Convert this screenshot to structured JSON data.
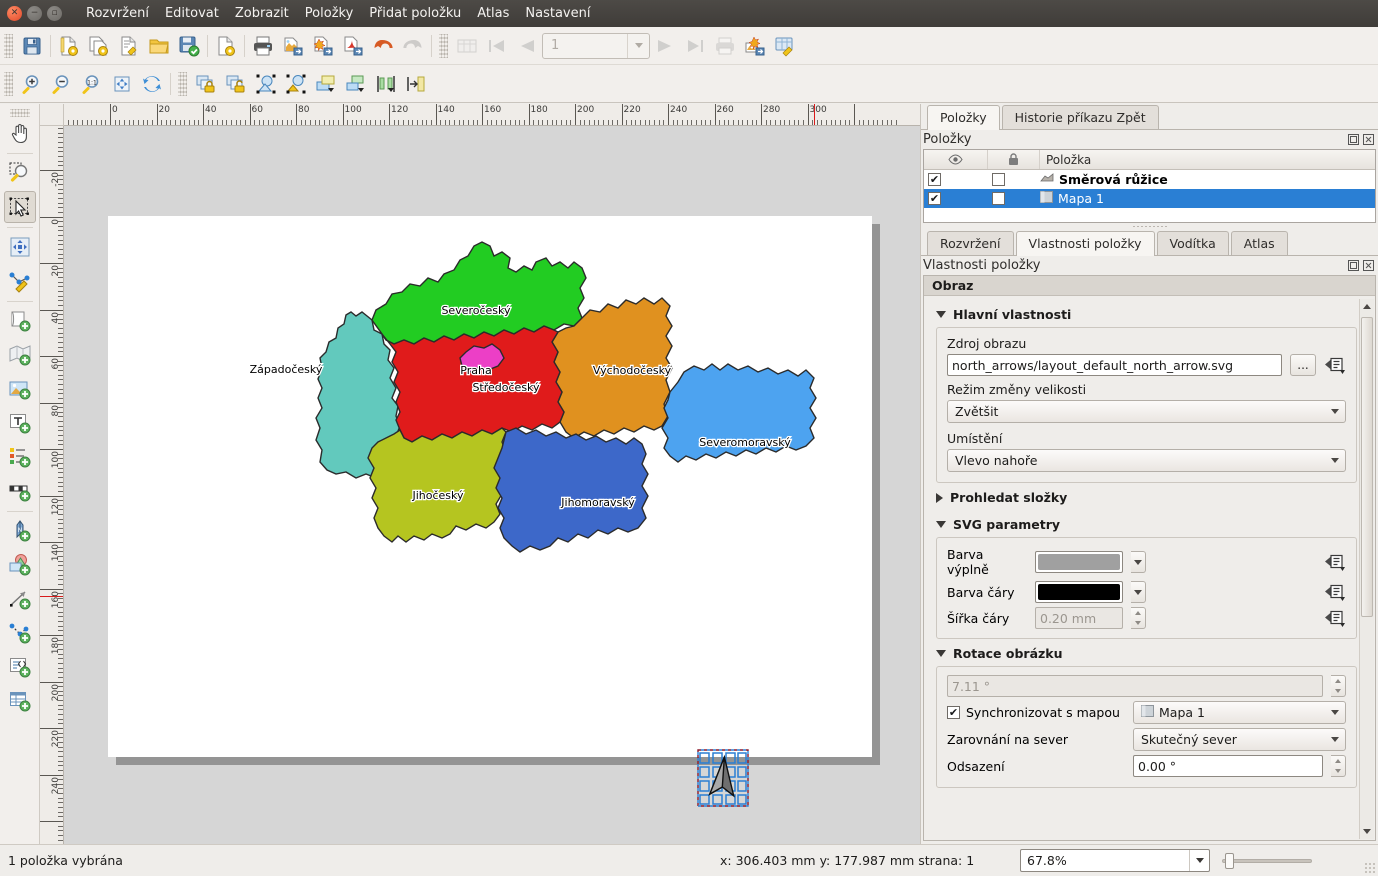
{
  "window": {
    "controls": [
      "close",
      "minimize",
      "maximize"
    ],
    "menus": [
      "Rozvržení",
      "Editovat",
      "Zobrazit",
      "Položky",
      "Přidat položku",
      "Atlas",
      "Nastavení"
    ]
  },
  "toolbar_top": {
    "buttons": [
      {
        "name": "save-icon",
        "tip": "Uložit"
      },
      {
        "name": "new-layout-icon",
        "tip": "Nové rozvržení"
      },
      {
        "name": "duplicate-layout-icon",
        "tip": "Duplikovat rozvržení"
      },
      {
        "name": "layout-manager-icon",
        "tip": "Správce rozvržení"
      },
      {
        "name": "open-folder-icon",
        "tip": "Otevřít"
      },
      {
        "name": "save-template-icon",
        "tip": "Uložit jako šablonu"
      },
      {
        "name": "new-from-template-icon",
        "tip": "Nové z šablony"
      },
      {
        "name": "print-icon",
        "tip": "Tisk"
      },
      {
        "name": "export-image-icon",
        "tip": "Exportovat jako obrázek"
      },
      {
        "name": "export-svg-icon",
        "tip": "Exportovat jako SVG"
      },
      {
        "name": "export-pdf-icon",
        "tip": "Exportovat jako PDF"
      },
      {
        "name": "undo-icon",
        "tip": "Zpět"
      },
      {
        "name": "redo-icon",
        "tip": "Znovu"
      }
    ],
    "atlas": [
      {
        "name": "atlas-preview-icon",
        "tip": "Náhled atlasu"
      },
      {
        "name": "atlas-first-icon",
        "tip": "První prvek"
      },
      {
        "name": "atlas-prev-icon",
        "tip": "Předchozí prvek"
      },
      {
        "name": "atlas-page-input",
        "value": "1"
      },
      {
        "name": "atlas-next-icon",
        "tip": "Další prvek"
      },
      {
        "name": "atlas-last-icon",
        "tip": "Poslední prvek"
      },
      {
        "name": "atlas-print-icon",
        "tip": "Tisknout atlas"
      },
      {
        "name": "atlas-export-image-icon",
        "tip": "Exportovat atlas jako obrázky"
      },
      {
        "name": "atlas-settings-icon",
        "tip": "Nastavení atlasu"
      }
    ]
  },
  "toolbar_second": {
    "buttons": [
      {
        "name": "zoom-in-icon"
      },
      {
        "name": "zoom-out-icon"
      },
      {
        "name": "zoom-100-icon"
      },
      {
        "name": "zoom-full-icon"
      },
      {
        "name": "refresh-icon"
      },
      {
        "name": "lock-items-icon"
      },
      {
        "name": "unlock-items-icon"
      },
      {
        "name": "group-items-icon"
      },
      {
        "name": "ungroup-items-icon"
      },
      {
        "name": "raise-items-icon"
      },
      {
        "name": "lower-items-icon"
      },
      {
        "name": "align-left-icon"
      },
      {
        "name": "distribute-icon"
      }
    ]
  },
  "left_toolbar": {
    "tools": [
      {
        "name": "pan-tool",
        "label": "Posunout obsah"
      },
      {
        "name": "zoom-tool",
        "label": "Přiblížit"
      },
      {
        "name": "select-move-item-tool",
        "label": "Vybrat/přesunout položku",
        "selected": true
      },
      {
        "name": "move-item-content-tool",
        "label": "Posunout obsah položky"
      },
      {
        "name": "edit-nodes-tool",
        "label": "Upravit uzly položky"
      },
      {
        "name": "add-page-tool",
        "label": "Přidat stránky"
      },
      {
        "name": "add-map-tool",
        "label": "Přidat mapu"
      },
      {
        "name": "add-picture-tool",
        "label": "Přidat obrázek"
      },
      {
        "name": "add-label-tool",
        "label": "Přidat popisek"
      },
      {
        "name": "add-legend-tool",
        "label": "Přidat legendu"
      },
      {
        "name": "add-scalebar-tool",
        "label": "Přidat měřítko"
      },
      {
        "name": "add-north-arrow-tool",
        "label": "Přidat směrovou růžici"
      },
      {
        "name": "add-shape-tool",
        "label": "Přidat tvar"
      },
      {
        "name": "add-arrow-tool",
        "label": "Přidat šipku"
      },
      {
        "name": "add-node-item-tool",
        "label": "Přidat uzlovou položku"
      },
      {
        "name": "add-html-tool",
        "label": "Přidat HTML rámec"
      },
      {
        "name": "add-attribute-table-tool",
        "label": "Přidat atributovou tabulku"
      }
    ]
  },
  "rulers": {
    "h_labels": [
      "0",
      "20",
      "40",
      "60",
      "80",
      "100",
      "120",
      "140",
      "160",
      "180",
      "200",
      "220",
      "240",
      "260",
      "280",
      "300"
    ],
    "v_labels": [
      "-20",
      "0",
      "20",
      "40",
      "60",
      "80",
      "100",
      "120",
      "140",
      "160",
      "180",
      "200",
      "220",
      "240"
    ],
    "unit": "mm"
  },
  "canvas": {
    "page_number": 1,
    "map_item_name": "Mapa 1",
    "north_arrow_name": "Směrová růžice",
    "map_regions": [
      {
        "name": "Severočeský",
        "color": "#22cc22"
      },
      {
        "name": "Západočeský",
        "color": "#62c9bd"
      },
      {
        "name": "Středočeský",
        "color": "#e01b1b"
      },
      {
        "name": "Praha",
        "color": "#ec3fc6"
      },
      {
        "name": "Východočeský",
        "color": "#e0911f"
      },
      {
        "name": "Severomoravský",
        "color": "#4da3f0"
      },
      {
        "name": "Jihočeský",
        "color": "#b5c520"
      },
      {
        "name": "Jihomoravský",
        "color": "#3d68c9"
      }
    ]
  },
  "dock": {
    "top_tabs": [
      {
        "label": "Položky",
        "selected": true
      },
      {
        "label": "Historie příkazu Zpět",
        "selected": false
      }
    ],
    "items_panel": {
      "title": "Položky",
      "columns": [
        "eye-icon",
        "lock-icon",
        "Položka"
      ],
      "rows": [
        {
          "visible": true,
          "locked": false,
          "icon": "north-arrow-icon",
          "name": "Směrová růžice",
          "selected": false,
          "bold": true
        },
        {
          "visible": true,
          "locked": false,
          "icon": "map-icon",
          "name": "Mapa 1",
          "selected": true,
          "bold": false
        }
      ]
    },
    "bottom_tabs": [
      {
        "label": "Rozvržení",
        "selected": false
      },
      {
        "label": "Vlastnosti položky",
        "selected": true
      },
      {
        "label": "Vodítka",
        "selected": false
      },
      {
        "label": "Atlas",
        "selected": false
      }
    ],
    "props_panel": {
      "title": "Vlastnosti položky",
      "group": "Obraz",
      "sections": [
        {
          "name": "main-properties",
          "title": "Hlavní vlastnosti",
          "expanded": true,
          "fields": [
            {
              "label": "Zdroj obrazu",
              "type": "text",
              "value": "north_arrows/layout_default_north_arrow.svg",
              "button": "...",
              "has_data_defined": true
            },
            {
              "label": "Režim změny velikosti",
              "type": "combo",
              "value": "Zvětšit"
            },
            {
              "label": "Umístění",
              "type": "combo",
              "value": "Vlevo nahoře"
            }
          ]
        },
        {
          "name": "search-directories",
          "title": "Prohledat složky",
          "expanded": false,
          "fields": []
        },
        {
          "name": "svg-parameters",
          "title": "SVG parametry",
          "expanded": true,
          "fields": [
            {
              "label": "Barva výplně",
              "type": "color",
              "value": "#a0a0a0",
              "has_data_defined": true
            },
            {
              "label": "Barva čáry",
              "type": "color",
              "value": "#000000",
              "has_data_defined": true
            },
            {
              "label": "Šířka čáry",
              "type": "spin",
              "value": "0.20 mm",
              "disabled": true,
              "has_data_defined": true
            }
          ]
        },
        {
          "name": "image-rotation",
          "title": "Rotace obrázku",
          "expanded": true,
          "fields": [
            {
              "label": "",
              "type": "spin",
              "value": "7.11 °",
              "disabled": true
            },
            {
              "label": "Synchronizovat s mapou",
              "type": "checkbox-combo",
              "checked": true,
              "value": "Mapa 1"
            },
            {
              "label": "Zarovnání na sever",
              "type": "combo",
              "value": "Skutečný sever"
            },
            {
              "label": "Odsazení",
              "type": "spin",
              "value": "0.00 °"
            }
          ]
        }
      ]
    }
  },
  "statusbar": {
    "selection": "1 položka vybrána",
    "coords": "x: 306.403 mm  y: 177.987 mm  strana: 1",
    "zoom": "67.8%"
  },
  "colors": {
    "accent": "#2a7fd4",
    "titlebar": "#3f3c39",
    "panel": "#efedea",
    "canvas_bg": "#d6d6d6"
  }
}
